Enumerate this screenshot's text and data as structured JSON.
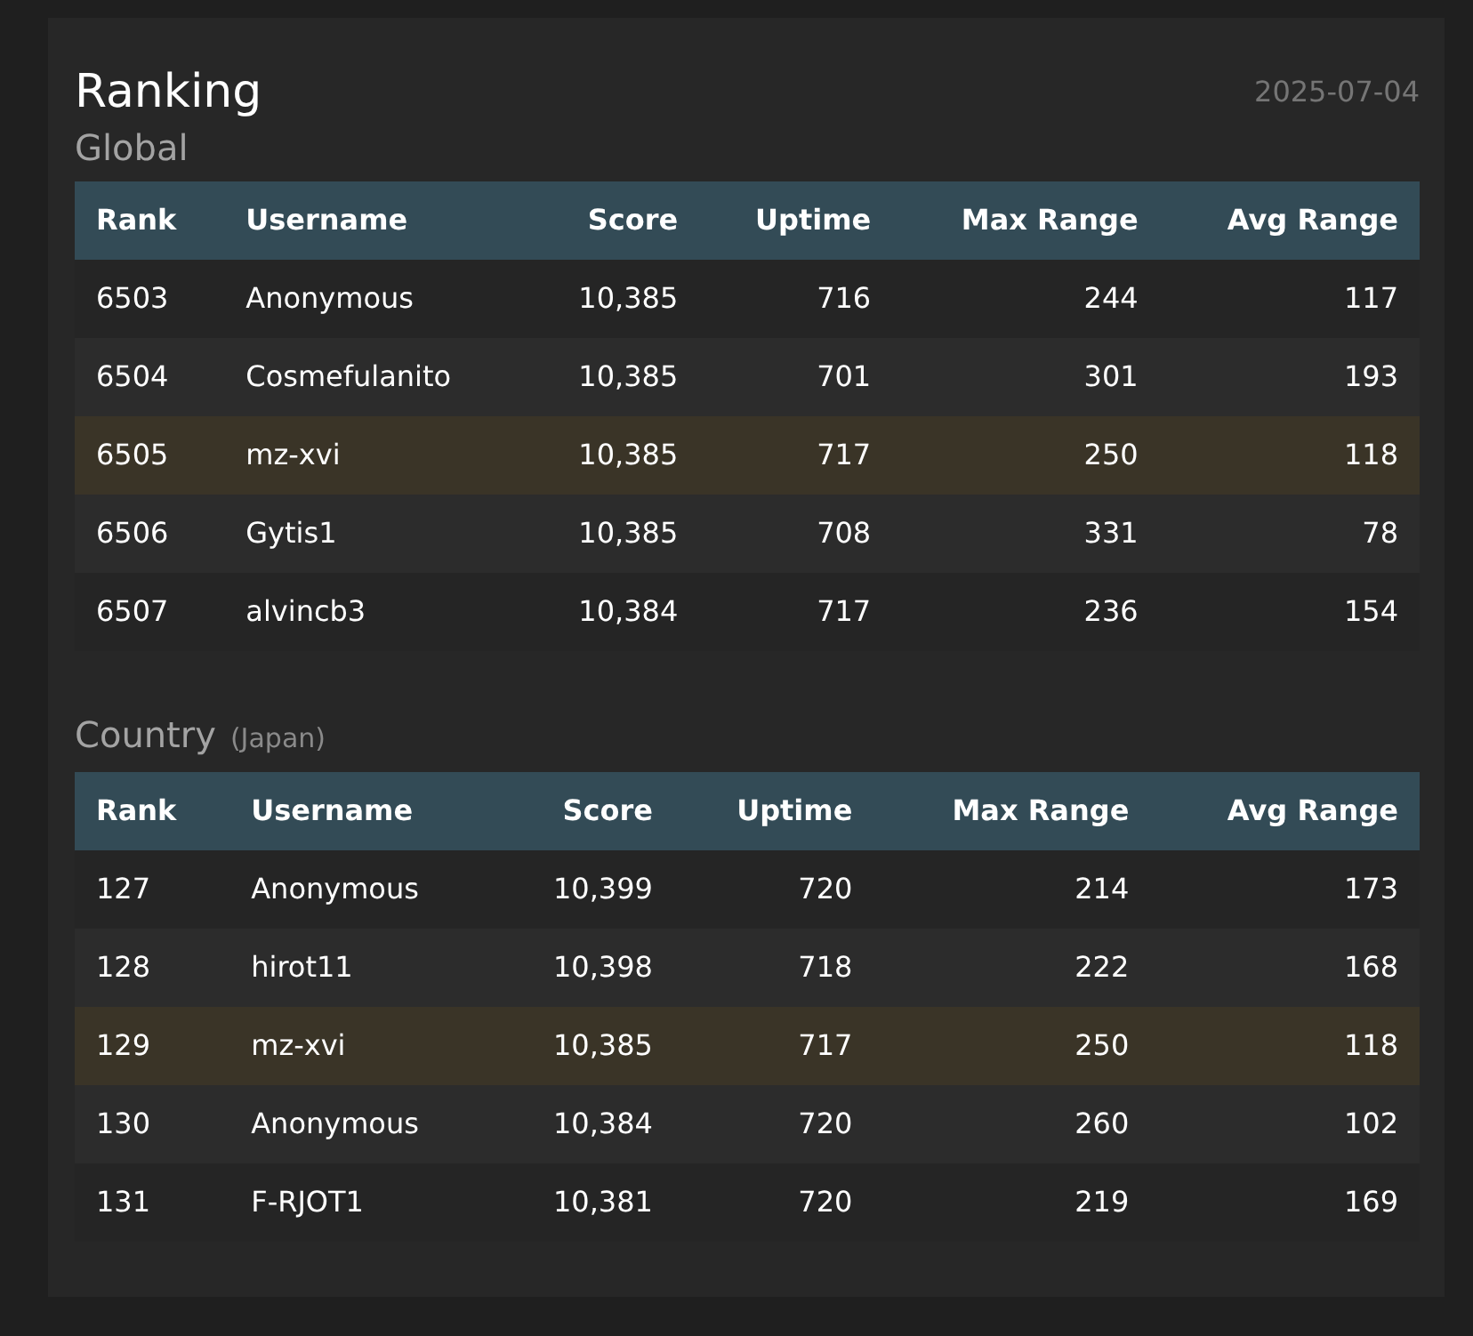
{
  "title": "Ranking",
  "date": "2025-07-04",
  "sections": [
    {
      "heading": "Global",
      "columns": [
        "Rank",
        "Username",
        "Score",
        "Uptime",
        "Max Range",
        "Avg Range"
      ],
      "rows": [
        {
          "cells": [
            "6503",
            "Anonymous",
            "10,385",
            "716",
            "244",
            "117"
          ],
          "highlighted": false
        },
        {
          "cells": [
            "6504",
            "Cosmefulanito",
            "10,385",
            "701",
            "301",
            "193"
          ],
          "highlighted": false
        },
        {
          "cells": [
            "6505",
            "mz-xvi",
            "10,385",
            "717",
            "250",
            "118"
          ],
          "highlighted": true
        },
        {
          "cells": [
            "6506",
            "Gytis1",
            "10,385",
            "708",
            "331",
            "78"
          ],
          "highlighted": false
        },
        {
          "cells": [
            "6507",
            "alvincb3",
            "10,384",
            "717",
            "236",
            "154"
          ],
          "highlighted": false
        }
      ]
    },
    {
      "heading": "Country",
      "subheading": "(Japan)",
      "columns": [
        "Rank",
        "Username",
        "Score",
        "Uptime",
        "Max Range",
        "Avg Range"
      ],
      "rows": [
        {
          "cells": [
            "127",
            "Anonymous",
            "10,399",
            "720",
            "214",
            "173"
          ],
          "highlighted": false
        },
        {
          "cells": [
            "128",
            "hirot11",
            "10,398",
            "718",
            "222",
            "168"
          ],
          "highlighted": false
        },
        {
          "cells": [
            "129",
            "mz-xvi",
            "10,385",
            "717",
            "250",
            "118"
          ],
          "highlighted": true
        },
        {
          "cells": [
            "130",
            "Anonymous",
            "10,384",
            "720",
            "260",
            "102"
          ],
          "highlighted": false
        },
        {
          "cells": [
            "131",
            "F-RJOT1",
            "10,381",
            "720",
            "219",
            "169"
          ],
          "highlighted": false
        }
      ]
    }
  ]
}
